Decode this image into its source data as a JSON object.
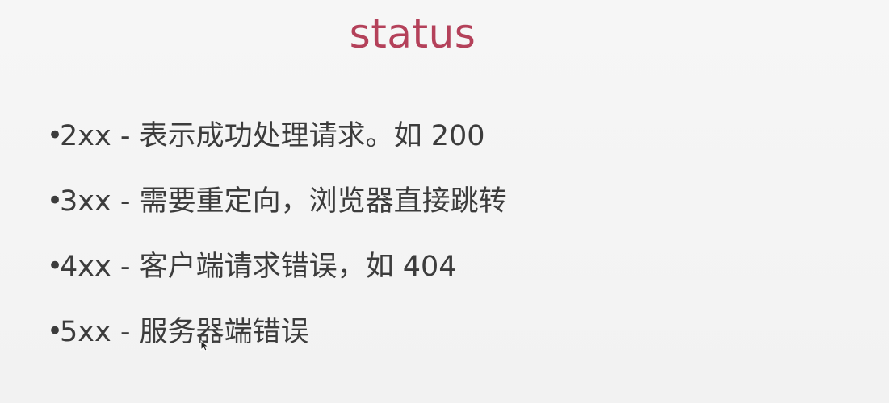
{
  "slide": {
    "title": "status",
    "bullet_symbol": "•",
    "items": [
      {
        "text": "2xx - 表示成功处理请求。如 200"
      },
      {
        "text": "3xx - 需要重定向，浏览器直接跳转"
      },
      {
        "text": "4xx - 客户端请求错误，如 404"
      },
      {
        "text": "5xx - 服务器端错误"
      }
    ],
    "colors": {
      "title": "#b4415a",
      "body_text": "#3c3c3c",
      "background": "#f4f4f4"
    }
  },
  "cursor": {
    "icon": "mouse-pointer-icon"
  }
}
